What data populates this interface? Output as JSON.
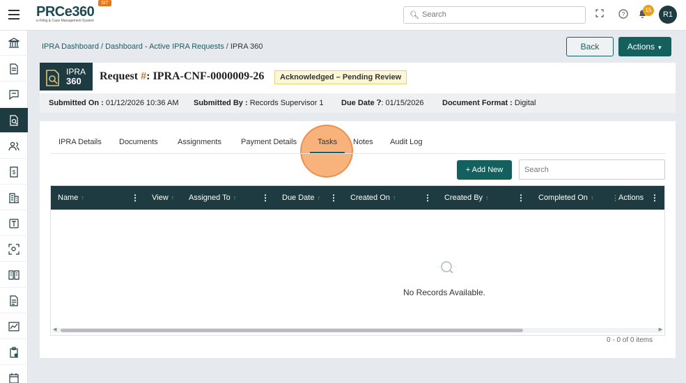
{
  "topbar": {
    "logo": "PRCe360",
    "logo_sub": "e-Filing & Case Management System",
    "env_badge": "SIT",
    "search_placeholder": "Search",
    "notification_count": "15",
    "avatar_initials": "R1"
  },
  "breadcrumb": {
    "items": [
      "IPRA Dashboard",
      "Dashboard - Active IPRA Requests"
    ],
    "current": "IPRA 360"
  },
  "buttons": {
    "back": "Back",
    "actions": "Actions"
  },
  "request": {
    "tag_line1": "IPRA",
    "tag_line2": "360",
    "label": "Request ",
    "hash": "#",
    "number": ": IPRA-CNF-0000009-26",
    "status": "Acknowledged – Pending Review"
  },
  "meta": {
    "submitted_on_label": "Submitted On :",
    "submitted_on": "01/12/2026 10:36 AM",
    "submitted_by_label": "Submitted By :",
    "submitted_by": "Records Supervisor 1",
    "due_date_label": "Due Date",
    "due_date": ": 01/15/2026",
    "format_label": "Document Format :",
    "format": "Digital"
  },
  "tabs": [
    "IPRA Details",
    "Documents",
    "Assignments",
    "Payment Details",
    "Tasks",
    "Notes",
    "Audit Log"
  ],
  "active_tab": "Tasks",
  "grid": {
    "add_button": "+ Add New",
    "search_placeholder": "Search",
    "columns": [
      "Name",
      "View",
      "Assigned To",
      "Due Date",
      "Created On",
      "Created By",
      "Completed On",
      "Actions"
    ],
    "empty_text": "No Records Available.",
    "pager": "0 - 0 of 0 items"
  },
  "colors": {
    "primary": "#1d3b40",
    "accent": "#14605f",
    "highlight": "#f6a05c"
  }
}
